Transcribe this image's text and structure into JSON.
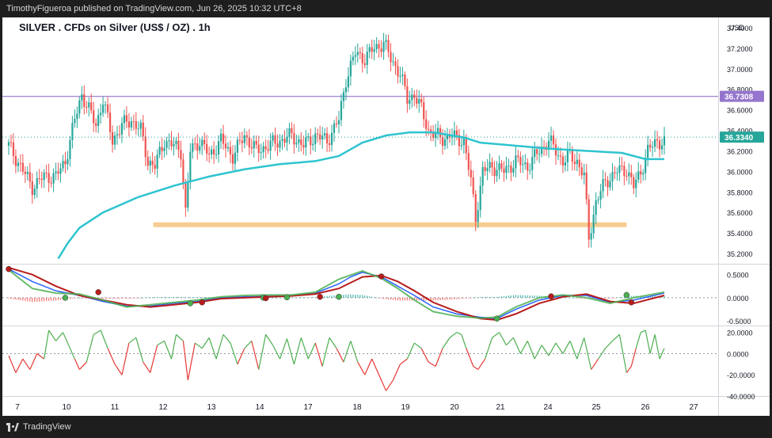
{
  "header": {
    "publisher_line": "TimothyFigueroa published on TradingView.com, Jun 26, 2025 10:32 UTC+8"
  },
  "footer": {
    "brand": "TradingView"
  },
  "chart": {
    "title": "SILVER . CFDs on Silver (US$ / OZ) . 1h",
    "currency": "USD"
  },
  "colors": {
    "bull": "#26a69a",
    "bear": "#ef5350",
    "ma": "#2ec4cf",
    "hline": "#9575cd",
    "support": "#f7c98b",
    "macd": "#2962ff",
    "signal": "#b71c1c",
    "osc_up": "#4caf50",
    "osc_down": "#e53935"
  },
  "chart_data": [
    {
      "type": "candlestick",
      "title": "SILVER . CFDs on Silver (US$ / OZ) . 1h",
      "x_tick_labels": [
        "7",
        "10",
        "11",
        "12",
        "13",
        "14",
        "17",
        "18",
        "19",
        "20",
        "21",
        "24",
        "25",
        "26",
        "27"
      ],
      "y_tick_labels": [
        "35.2000",
        "35.4000",
        "35.6000",
        "35.8000",
        "36.0000",
        "36.2000",
        "36.4000",
        "36.6000",
        "36.8000",
        "37.0000",
        "37.2000",
        "37.4000"
      ],
      "ylim": [
        35.1,
        37.5
      ],
      "close_path": [
        [
          0,
          36.25
        ],
        [
          5,
          36.05
        ],
        [
          10,
          35.85
        ],
        [
          15,
          35.95
        ],
        [
          20,
          35.95
        ],
        [
          24,
          36.1
        ],
        [
          28,
          36.5
        ],
        [
          31,
          36.75
        ],
        [
          34,
          36.6
        ],
        [
          37,
          36.45
        ],
        [
          40,
          36.7
        ],
        [
          44,
          36.3
        ],
        [
          48,
          36.45
        ],
        [
          52,
          36.5
        ],
        [
          56,
          36.4
        ],
        [
          59,
          36.1
        ],
        [
          62,
          36.05
        ],
        [
          66,
          36.3
        ],
        [
          70,
          36.25
        ],
        [
          73,
          36.2
        ],
        [
          75,
          35.6
        ],
        [
          77,
          36.2
        ],
        [
          81,
          36.3
        ],
        [
          85,
          36.15
        ],
        [
          90,
          36.3
        ],
        [
          95,
          36.15
        ],
        [
          100,
          36.35
        ],
        [
          105,
          36.2
        ],
        [
          110,
          36.25
        ],
        [
          115,
          36.3
        ],
        [
          120,
          36.35
        ],
        [
          125,
          36.25
        ],
        [
          130,
          36.35
        ],
        [
          135,
          36.3
        ],
        [
          140,
          36.5
        ],
        [
          143,
          36.9
        ],
        [
          147,
          37.15
        ],
        [
          151,
          37.1
        ],
        [
          155,
          37.2
        ],
        [
          159,
          37.25
        ],
        [
          162,
          37.1
        ],
        [
          166,
          36.95
        ],
        [
          169,
          36.7
        ],
        [
          172,
          36.75
        ],
        [
          175,
          36.6
        ],
        [
          178,
          36.4
        ],
        [
          181,
          36.35
        ],
        [
          184,
          36.32
        ],
        [
          187,
          36.35
        ],
        [
          190,
          36.32
        ],
        [
          193,
          36.3
        ],
        [
          196,
          35.9
        ],
        [
          198,
          35.55
        ],
        [
          201,
          36.0
        ],
        [
          205,
          36.05
        ],
        [
          210,
          36.0
        ],
        [
          215,
          36.1
        ],
        [
          220,
          36.05
        ],
        [
          225,
          36.2
        ],
        [
          229,
          36.3
        ],
        [
          232,
          36.2
        ],
        [
          235,
          36.1
        ],
        [
          238,
          36.15
        ],
        [
          241,
          36.1
        ],
        [
          244,
          35.95
        ],
        [
          246,
          35.35
        ],
        [
          249,
          35.7
        ],
        [
          253,
          35.9
        ],
        [
          258,
          36.0
        ],
        [
          262,
          36.02
        ],
        [
          265,
          35.85
        ],
        [
          268,
          36.0
        ],
        [
          271,
          36.2
        ],
        [
          275,
          36.3
        ],
        [
          278,
          36.28
        ]
      ],
      "moving_average": [
        [
          21,
          35.15
        ],
        [
          25,
          35.3
        ],
        [
          30,
          35.45
        ],
        [
          40,
          35.6
        ],
        [
          55,
          35.75
        ],
        [
          70,
          35.86
        ],
        [
          85,
          35.95
        ],
        [
          100,
          36.02
        ],
        [
          115,
          36.07
        ],
        [
          130,
          36.1
        ],
        [
          140,
          36.15
        ],
        [
          150,
          36.28
        ],
        [
          160,
          36.35
        ],
        [
          170,
          36.38
        ],
        [
          180,
          36.38
        ],
        [
          193,
          36.33
        ],
        [
          200,
          36.28
        ],
        [
          215,
          36.25
        ],
        [
          230,
          36.22
        ],
        [
          245,
          36.2
        ],
        [
          260,
          36.18
        ],
        [
          270,
          36.12
        ],
        [
          278,
          36.12
        ]
      ],
      "horizontal_level": {
        "value": 36.7308,
        "label": "36.7308"
      },
      "last_price": {
        "value": 36.334,
        "label": "36.3340"
      },
      "support_zone": {
        "value": 35.48,
        "from": 21,
        "to": 262
      }
    },
    {
      "type": "line",
      "name": "MACD panel",
      "y_tick_labels": [
        "0.5000",
        "0.0000",
        "-0.5000"
      ],
      "ylim": [
        -0.6,
        0.7
      ],
      "series": [
        {
          "values": [
            [
              0,
              0.62
            ],
            [
              10,
              0.35
            ],
            [
              20,
              0.15
            ],
            [
              30,
              0.05
            ],
            [
              40,
              -0.08
            ],
            [
              50,
              -0.18
            ],
            [
              60,
              -0.18
            ],
            [
              70,
              -0.12
            ],
            [
              80,
              -0.08
            ],
            [
              90,
              0.0
            ],
            [
              100,
              0.02
            ],
            [
              110,
              0.03
            ],
            [
              120,
              0.05
            ],
            [
              130,
              0.1
            ],
            [
              140,
              0.3
            ],
            [
              145,
              0.45
            ],
            [
              150,
              0.55
            ],
            [
              158,
              0.45
            ],
            [
              165,
              0.25
            ],
            [
              172,
              0.05
            ],
            [
              180,
              -0.2
            ],
            [
              190,
              -0.35
            ],
            [
              200,
              -0.42
            ],
            [
              207,
              -0.45
            ],
            [
              215,
              -0.25
            ],
            [
              225,
              -0.05
            ],
            [
              235,
              0.05
            ],
            [
              245,
              0.05
            ],
            [
              255,
              -0.1
            ],
            [
              265,
              -0.05
            ],
            [
              278,
              0.1
            ]
          ]
        },
        {
          "values": [
            [
              0,
              0.65
            ],
            [
              10,
              0.5
            ],
            [
              20,
              0.25
            ],
            [
              30,
              0.05
            ],
            [
              40,
              -0.05
            ],
            [
              50,
              -0.15
            ],
            [
              60,
              -0.2
            ],
            [
              70,
              -0.15
            ],
            [
              80,
              -0.1
            ],
            [
              90,
              -0.02
            ],
            [
              100,
              0.0
            ],
            [
              110,
              0.02
            ],
            [
              120,
              0.04
            ],
            [
              130,
              0.08
            ],
            [
              140,
              0.2
            ],
            [
              150,
              0.45
            ],
            [
              158,
              0.48
            ],
            [
              165,
              0.35
            ],
            [
              172,
              0.15
            ],
            [
              180,
              -0.1
            ],
            [
              190,
              -0.3
            ],
            [
              200,
              -0.45
            ],
            [
              207,
              -0.48
            ],
            [
              215,
              -0.35
            ],
            [
              225,
              -0.12
            ],
            [
              235,
              0.02
            ],
            [
              245,
              0.08
            ],
            [
              255,
              -0.08
            ],
            [
              265,
              -0.12
            ],
            [
              278,
              0.05
            ]
          ]
        },
        {
          "values": [
            [
              0,
              0.6
            ],
            [
              10,
              0.2
            ],
            [
              20,
              0.1
            ],
            [
              30,
              0.08
            ],
            [
              40,
              -0.05
            ],
            [
              50,
              -0.2
            ],
            [
              60,
              -0.15
            ],
            [
              70,
              -0.1
            ],
            [
              80,
              -0.05
            ],
            [
              90,
              0.02
            ],
            [
              100,
              0.05
            ],
            [
              110,
              0.06
            ],
            [
              120,
              0.06
            ],
            [
              130,
              0.12
            ],
            [
              140,
              0.4
            ],
            [
              150,
              0.58
            ],
            [
              158,
              0.42
            ],
            [
              165,
              0.2
            ],
            [
              172,
              -0.05
            ],
            [
              180,
              -0.3
            ],
            [
              190,
              -0.4
            ],
            [
              200,
              -0.44
            ],
            [
              207,
              -0.42
            ],
            [
              215,
              -0.2
            ],
            [
              225,
              0.0
            ],
            [
              235,
              0.06
            ],
            [
              245,
              0.0
            ],
            [
              255,
              -0.12
            ],
            [
              265,
              0.0
            ],
            [
              278,
              0.12
            ]
          ]
        }
      ]
    },
    {
      "type": "line",
      "name": "Oscillator panel",
      "y_tick_labels": [
        "20.0000",
        "0.0000",
        "-20.0000",
        "-40.0000"
      ],
      "ylim": [
        -40,
        25
      ],
      "values": [
        [
          0,
          -2
        ],
        [
          3,
          -18
        ],
        [
          6,
          -5
        ],
        [
          9,
          -15
        ],
        [
          12,
          0
        ],
        [
          15,
          -5
        ],
        [
          17,
          22
        ],
        [
          20,
          12
        ],
        [
          23,
          20
        ],
        [
          26,
          5
        ],
        [
          28,
          -5
        ],
        [
          30,
          -15
        ],
        [
          33,
          -8
        ],
        [
          36,
          18
        ],
        [
          39,
          22
        ],
        [
          42,
          5
        ],
        [
          45,
          -10
        ],
        [
          48,
          -20
        ],
        [
          51,
          10
        ],
        [
          54,
          15
        ],
        [
          57,
          -8
        ],
        [
          60,
          -18
        ],
        [
          63,
          8
        ],
        [
          66,
          12
        ],
        [
          69,
          -5
        ],
        [
          71,
          18
        ],
        [
          74,
          12
        ],
        [
          76,
          -25
        ],
        [
          79,
          10
        ],
        [
          82,
          5
        ],
        [
          85,
          15
        ],
        [
          88,
          -5
        ],
        [
          91,
          18
        ],
        [
          94,
          10
        ],
        [
          97,
          -10
        ],
        [
          100,
          5
        ],
        [
          103,
          12
        ],
        [
          106,
          -15
        ],
        [
          109,
          18
        ],
        [
          112,
          8
        ],
        [
          115,
          -5
        ],
        [
          118,
          14
        ],
        [
          121,
          -10
        ],
        [
          124,
          15
        ],
        [
          127,
          -5
        ],
        [
          130,
          10
        ],
        [
          133,
          -12
        ],
        [
          136,
          15
        ],
        [
          139,
          5
        ],
        [
          142,
          -8
        ],
        [
          145,
          12
        ],
        [
          148,
          -8
        ],
        [
          151,
          -20
        ],
        [
          154,
          -5
        ],
        [
          157,
          -20
        ],
        [
          160,
          -35
        ],
        [
          163,
          -25
        ],
        [
          166,
          -10
        ],
        [
          169,
          -5
        ],
        [
          172,
          10
        ],
        [
          175,
          5
        ],
        [
          178,
          -8
        ],
        [
          181,
          -12
        ],
        [
          184,
          5
        ],
        [
          187,
          15
        ],
        [
          190,
          20
        ],
        [
          192,
          18
        ],
        [
          194,
          5
        ],
        [
          197,
          -12
        ],
        [
          199,
          -15
        ],
        [
          202,
          -5
        ],
        [
          205,
          15
        ],
        [
          208,
          20
        ],
        [
          211,
          8
        ],
        [
          214,
          15
        ],
        [
          217,
          0
        ],
        [
          220,
          12
        ],
        [
          223,
          -5
        ],
        [
          226,
          8
        ],
        [
          229,
          -2
        ],
        [
          232,
          10
        ],
        [
          235,
          0
        ],
        [
          238,
          12
        ],
        [
          241,
          -5
        ],
        [
          244,
          15
        ],
        [
          247,
          -15
        ],
        [
          250,
          -5
        ],
        [
          253,
          5
        ],
        [
          256,
          12
        ],
        [
          259,
          18
        ],
        [
          262,
          -18
        ],
        [
          264,
          -12
        ],
        [
          266,
          5
        ],
        [
          268,
          20
        ],
        [
          270,
          22
        ],
        [
          272,
          0
        ],
        [
          274,
          18
        ],
        [
          276,
          -5
        ],
        [
          278,
          5
        ]
      ],
      "dots": [
        [
          0,
          0.62
        ],
        [
          24,
          0.0
        ],
        [
          38,
          0.12
        ],
        [
          77,
          -0.12
        ],
        [
          82,
          -0.1
        ],
        [
          108,
          0.0
        ],
        [
          109,
          -0.01
        ],
        [
          118,
          0.01
        ],
        [
          132,
          0.02
        ],
        [
          140,
          0.02
        ],
        [
          158,
          0.46
        ],
        [
          207,
          -0.45
        ],
        [
          230,
          0.03
        ],
        [
          262,
          0.06
        ],
        [
          264,
          -0.1
        ]
      ]
    }
  ]
}
